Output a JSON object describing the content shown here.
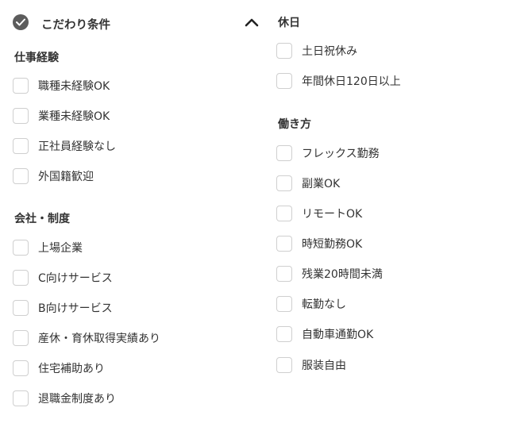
{
  "header": {
    "title": "こだわり条件"
  },
  "left": {
    "sections": [
      {
        "title": "仕事経験",
        "items": [
          "職種未経験OK",
          "業種未経験OK",
          "正社員経験なし",
          "外国籍歓迎"
        ]
      },
      {
        "title": "会社・制度",
        "items": [
          "上場企業",
          "C向けサービス",
          "B向けサービス",
          "産休・育休取得実績あり",
          "住宅補助あり",
          "退職金制度あり"
        ]
      }
    ]
  },
  "right": {
    "sections": [
      {
        "title": "休日",
        "items": [
          "土日祝休み",
          "年間休日120日以上"
        ]
      },
      {
        "title": "働き方",
        "items": [
          "フレックス勤務",
          "副業OK",
          "リモートOK",
          "時短勤務OK",
          "残業20時間未満",
          "転勤なし",
          "自動車通勤OK",
          "服装自由"
        ]
      }
    ]
  },
  "icons": {
    "header_check": "check-circle-icon",
    "toggle": "chevron-up-icon",
    "checkbox": "checkbox-unchecked"
  },
  "colors": {
    "checkbox_border": "#cfcfcf",
    "icon_fill": "#5c5c5c",
    "text": "#333333"
  }
}
